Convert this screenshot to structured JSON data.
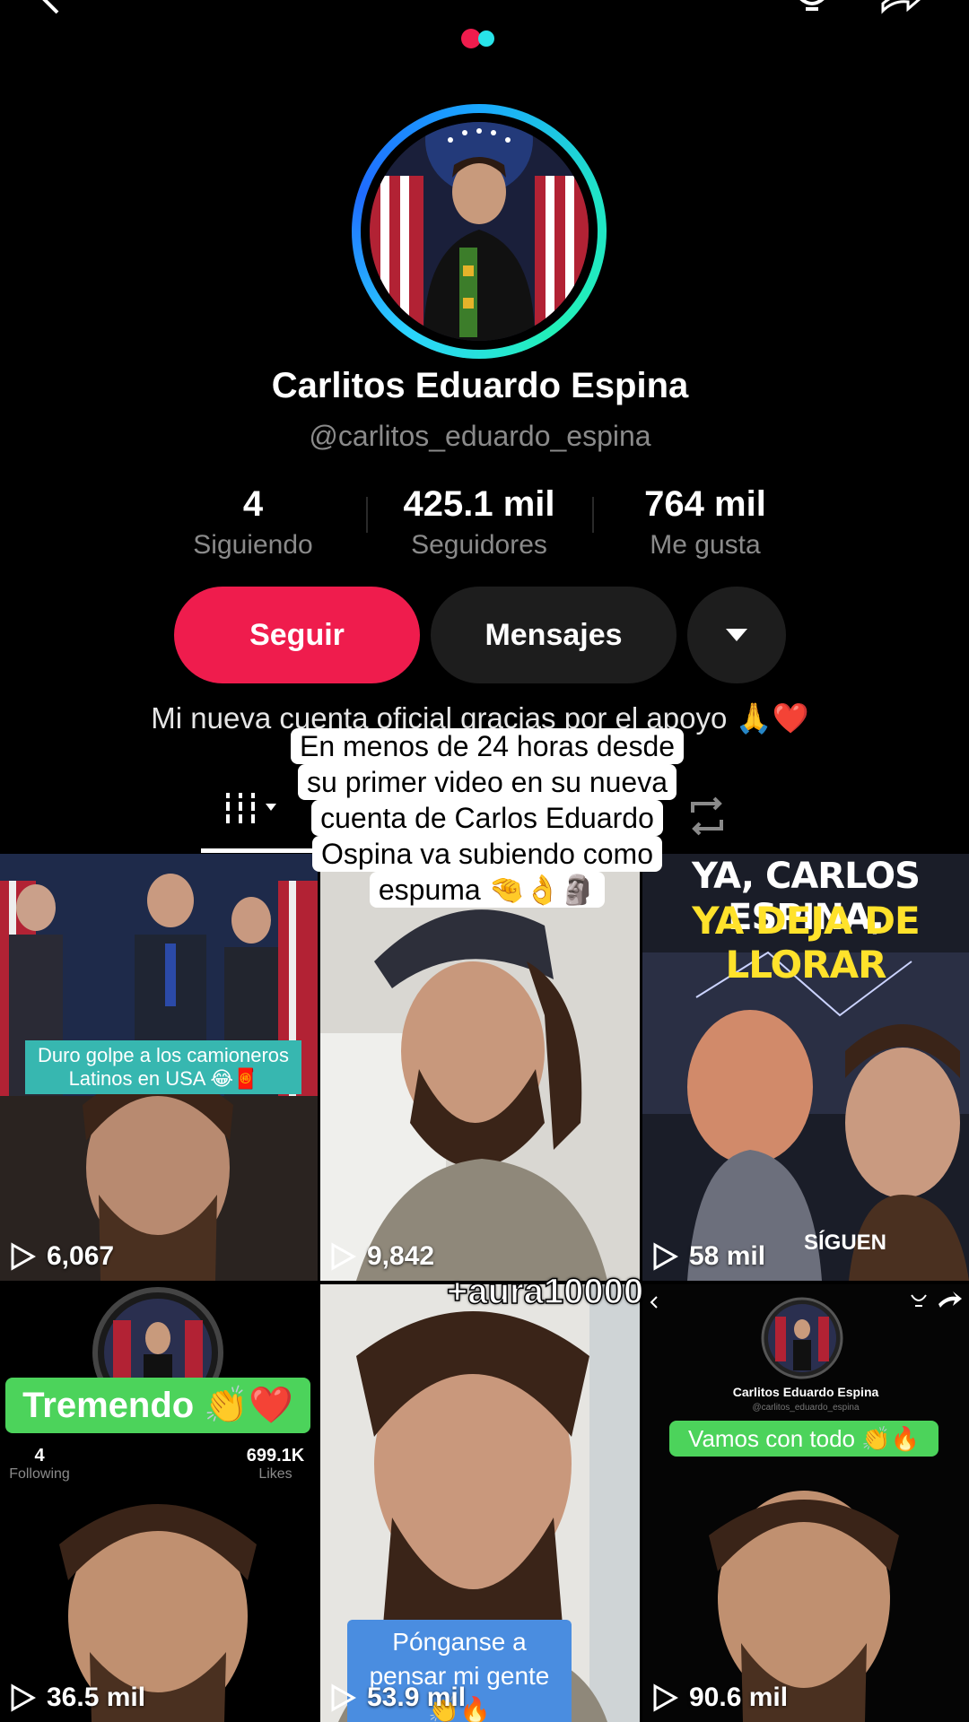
{
  "profile": {
    "name": "Carlitos Eduardo Espina",
    "handle": "@carlitos_eduardo_espina",
    "bio": "Mi nueva cuenta oficial gracias por el apoyo 🙏❤️",
    "stats": [
      {
        "value": "4",
        "label": "Siguiendo"
      },
      {
        "value": "425.1 mil",
        "label": "Seguidores"
      },
      {
        "value": "764 mil",
        "label": "Me gusta"
      }
    ]
  },
  "buttons": {
    "follow": "Seguir",
    "message": "Mensajes"
  },
  "overlay": {
    "caption": "En menos de 24 horas desde su primer video en su nueva cuenta de Carlos Eduardo Ospina va subiendo como espuma 🤏👌🗿",
    "aura": "+aura10000"
  },
  "videos": [
    {
      "views": "6,067",
      "tag": "Duro golpe a los camioneros Latinos en USA 😂🧧"
    },
    {
      "views": "9,842"
    },
    {
      "views": "58 mil",
      "headline_1": "YA, CARLOS ESPINA,",
      "headline_2": "YA DEJA DE LLORAR",
      "overlay_text": "SÍGUEN"
    },
    {
      "views": "36.5 mil",
      "tag": "Tremendo 👏❤️",
      "following": "4",
      "following_label": "Following",
      "likes": "699.1K",
      "likes_label": "Likes"
    },
    {
      "views": "53.9 mil",
      "tag": "Pónganse a pensar  mi gente 👏🔥"
    },
    {
      "views": "90.6 mil",
      "name": "Carlitos Eduardo Espina",
      "handle": "@carlitos_eduardo_espina",
      "tag": "Vamos con todo 👏🔥"
    }
  ],
  "colors": {
    "accent": "#ef1c4d",
    "ring_start": "#1aa8ff",
    "ring_end": "#20e3c8",
    "secondary_button": "#1d1d1d"
  }
}
